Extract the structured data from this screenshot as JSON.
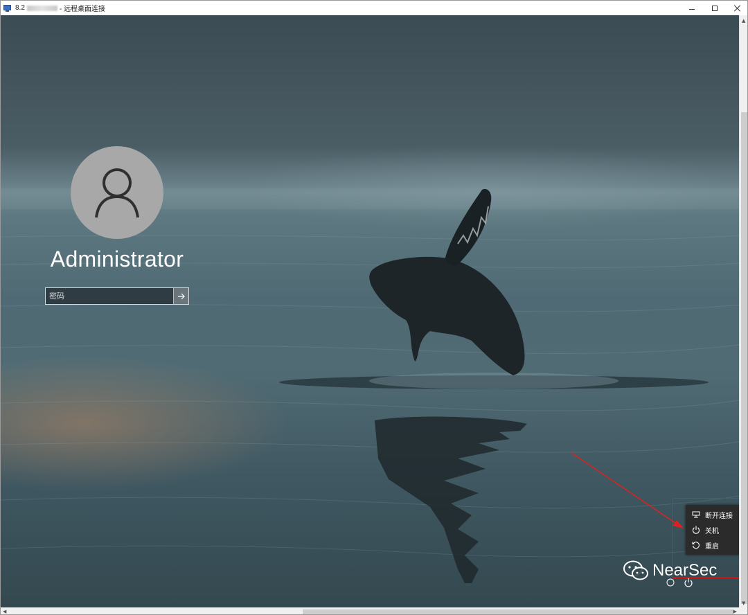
{
  "window": {
    "title_prefix": "8.2",
    "title_suffix": "- 远程桌面连接",
    "controls": {
      "minimize": "minimize-icon",
      "maximize": "maximize-icon",
      "close": "close-icon"
    }
  },
  "login": {
    "username": "Administrator",
    "password_placeholder": "密码",
    "submit_icon": "arrow-right-icon"
  },
  "power_menu": {
    "items": [
      {
        "label": "断开连接",
        "icon": "disconnect-icon"
      },
      {
        "label": "关机",
        "icon": "power-icon"
      },
      {
        "label": "重启",
        "icon": "restart-icon"
      }
    ]
  },
  "watermark": {
    "text": "NearSec"
  },
  "colors": {
    "highlight": "#e02020",
    "menu_bg": "#2b2b2b",
    "avatar_bg": "#a8a8a8"
  }
}
